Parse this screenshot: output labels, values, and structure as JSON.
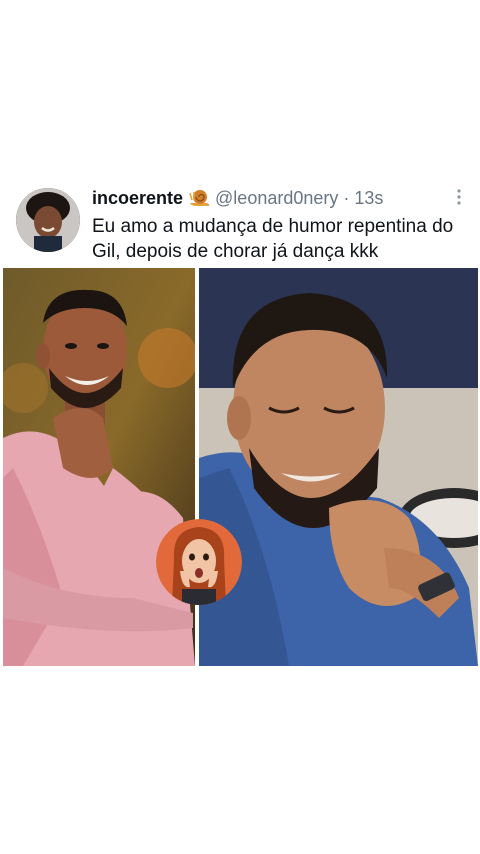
{
  "tweet": {
    "display_name": "incoerente",
    "badge_icon": "snail-emoji",
    "handle": "@leonard0nery",
    "separator": "·",
    "time": "13s",
    "more_icon": "more-vertical-icon",
    "text": "Eu amo a mudança de humor repentina do Gil, depois de chorar já dança kkk"
  },
  "colors": {
    "text_primary": "#0f1419",
    "text_secondary": "#687684",
    "background": "#ffffff"
  }
}
